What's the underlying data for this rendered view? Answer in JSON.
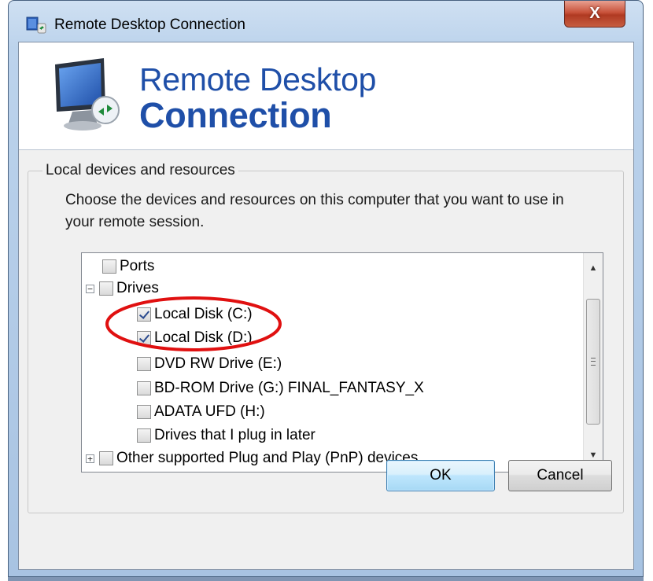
{
  "window": {
    "title": "Remote Desktop Connection",
    "close_label": "X"
  },
  "banner": {
    "line1": "Remote Desktop",
    "line2": "Connection"
  },
  "group": {
    "legend": "Local devices and resources",
    "description": "Choose the devices and resources on this computer that you want to use in your remote session."
  },
  "tree": {
    "items": [
      {
        "label": "Ports",
        "checked": false,
        "level": 1,
        "expander": ""
      },
      {
        "label": "Drives",
        "checked": false,
        "level": 1,
        "expander": "−"
      },
      {
        "label": "Local Disk (C:)",
        "checked": true,
        "level": 2,
        "expander": ""
      },
      {
        "label": "Local Disk (D:)",
        "checked": true,
        "level": 2,
        "expander": ""
      },
      {
        "label": "DVD RW Drive (E:)",
        "checked": false,
        "level": 2,
        "expander": ""
      },
      {
        "label": "BD-ROM Drive (G:) FINAL_FANTASY_X",
        "checked": false,
        "level": 2,
        "expander": ""
      },
      {
        "label": "ADATA UFD (H:)",
        "checked": false,
        "level": 2,
        "expander": ""
      },
      {
        "label": "Drives that I plug in later",
        "checked": false,
        "level": 2,
        "expander": ""
      },
      {
        "label": "Other supported Plug and Play (PnP) devices",
        "checked": false,
        "level": 1,
        "expander": "+"
      }
    ]
  },
  "buttons": {
    "ok": "OK",
    "cancel": "Cancel"
  },
  "colors": {
    "annotation": "#e01010",
    "banner_text": "#1f4fa8"
  }
}
